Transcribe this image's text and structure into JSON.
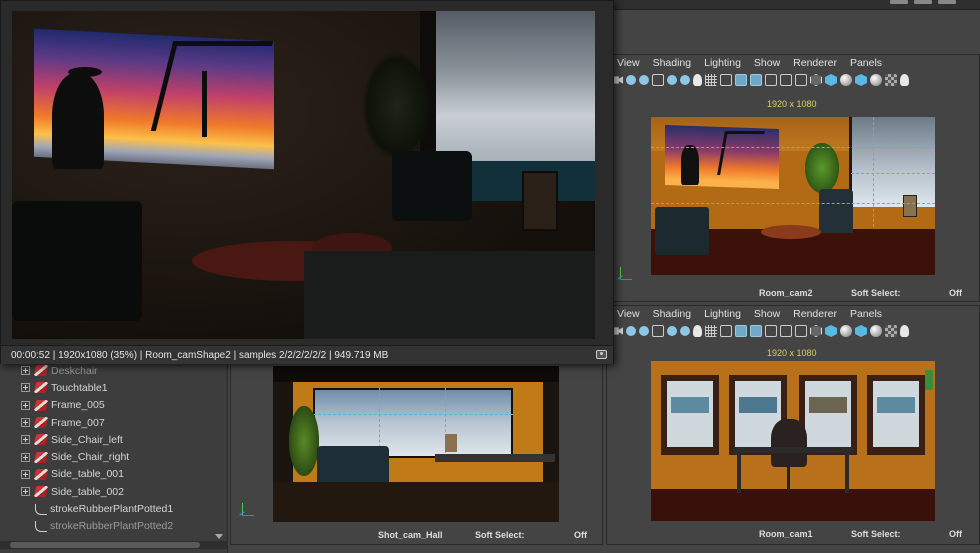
{
  "outliner": {
    "items": [
      {
        "label": "Deskchair",
        "type": "mesh",
        "dim": true
      },
      {
        "label": "Touchtable1",
        "type": "mesh"
      },
      {
        "label": "Frame_005",
        "type": "mesh"
      },
      {
        "label": "Frame_007",
        "type": "mesh"
      },
      {
        "label": "Side_Chair_left",
        "type": "mesh"
      },
      {
        "label": "Side_Chair_right",
        "type": "mesh"
      },
      {
        "label": "Side_table_001",
        "type": "mesh"
      },
      {
        "label": "Side_table_002",
        "type": "mesh"
      },
      {
        "label": "strokeRubberPlantPotted1",
        "type": "curve"
      },
      {
        "label": "strokeRubberPlantPotted2",
        "type": "curve",
        "dim": true
      }
    ]
  },
  "render_view": {
    "status": "00:00:52 | 1920x1080 (35%) | Room_camShape2 | samples 2/2/2/2/2/2 | 949.719 MB"
  },
  "panel_menu": {
    "view": "View",
    "shading": "Shading",
    "lighting": "Lighting",
    "show": "Show",
    "renderer": "Renderer",
    "panels": "Panels"
  },
  "panels": {
    "top_right": {
      "resolution": "1920 x 1080",
      "camera": "Room_cam2",
      "soft_select_label": "Soft Select:",
      "soft_select_value": "Off"
    },
    "bottom_right": {
      "resolution": "1920 x 1080",
      "camera": "Room_cam1",
      "soft_select_label": "Soft Select:",
      "soft_select_value": "Off"
    },
    "bottom_mid": {
      "camera": "Shot_cam_Hall",
      "soft_select_label": "Soft Select:",
      "soft_select_value": "Off"
    }
  },
  "axis_labels": {
    "y": "Y",
    "x": "X",
    "z": "Z"
  },
  "colors": {
    "accent": "#58b9e4",
    "resolution_gate": "#d8d066",
    "grid_guides": "#44bbdd"
  }
}
